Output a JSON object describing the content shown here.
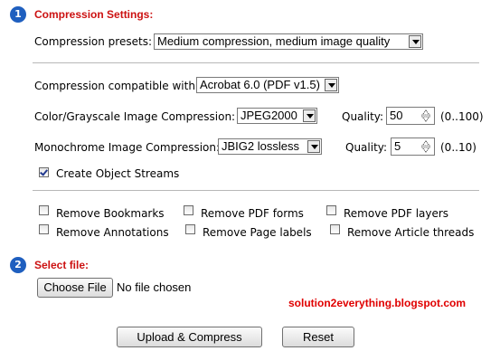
{
  "section1": {
    "number": "1",
    "title": "Compression Settings:",
    "presets_label": "Compression presets:",
    "presets_value": "Medium compression, medium image quality",
    "compat_label": "Compression compatible with:",
    "compat_value": "Acrobat 6.0 (PDF v1.5)",
    "color_label": "Color/Grayscale Image Compression:",
    "color_value": "JPEG2000",
    "color_quality_label": "Quality:",
    "color_quality_value": "50",
    "color_quality_range": "(0..100)",
    "mono_label": "Monochrome Image Compression:",
    "mono_value": "JBIG2 lossless",
    "mono_quality_label": "Quality:",
    "mono_quality_value": "5",
    "mono_quality_range": "(0..10)",
    "object_streams_label": "Create Object Streams",
    "object_streams_checked": true
  },
  "remove_options": [
    {
      "label": "Remove Bookmarks",
      "checked": false
    },
    {
      "label": "Remove PDF forms",
      "checked": false
    },
    {
      "label": "Remove PDF layers",
      "checked": false
    },
    {
      "label": "Remove Annotations",
      "checked": false
    },
    {
      "label": "Remove Page labels",
      "checked": false
    },
    {
      "label": "Remove Article threads",
      "checked": false
    }
  ],
  "section2": {
    "number": "2",
    "title": "Select file:",
    "choose_button": "Choose File",
    "file_status": "No file chosen"
  },
  "watermark": "solution2everything.blogspot.com",
  "buttons": {
    "upload": "Upload & Compress",
    "reset": "Reset"
  },
  "colors": {
    "accent": "#cc1111",
    "step_circle": "#1f5fbf",
    "watermark": "#e00000"
  }
}
